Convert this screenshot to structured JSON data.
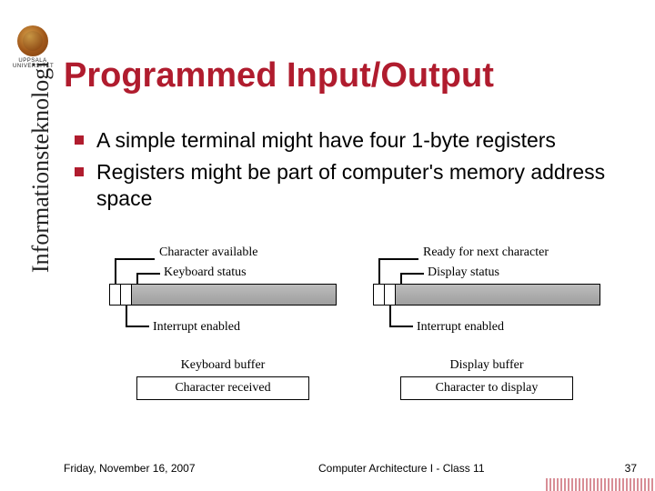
{
  "logo_caption": "UPPSALA UNIVERSITET",
  "title": "Programmed Input/Output",
  "sidebar": "Informationsteknologi",
  "bullets": [
    "A simple terminal might have four 1-byte registers",
    "Registers might be part of computer's memory address space"
  ],
  "diagram": {
    "left": {
      "top_ann": "Character available",
      "side_label": "Keyboard status",
      "bot_ann": "Interrupt enabled",
      "buf_label": "Keyboard buffer",
      "buf_text": "Character received"
    },
    "right": {
      "top_ann": "Ready for next character",
      "side_label": "Display status",
      "bot_ann": "Interrupt enabled",
      "buf_label": "Display buffer",
      "buf_text": "Character to display"
    }
  },
  "footer": {
    "date": "Friday, November 16, 2007",
    "course": "Computer Architecture I - Class 11",
    "page": "37"
  }
}
